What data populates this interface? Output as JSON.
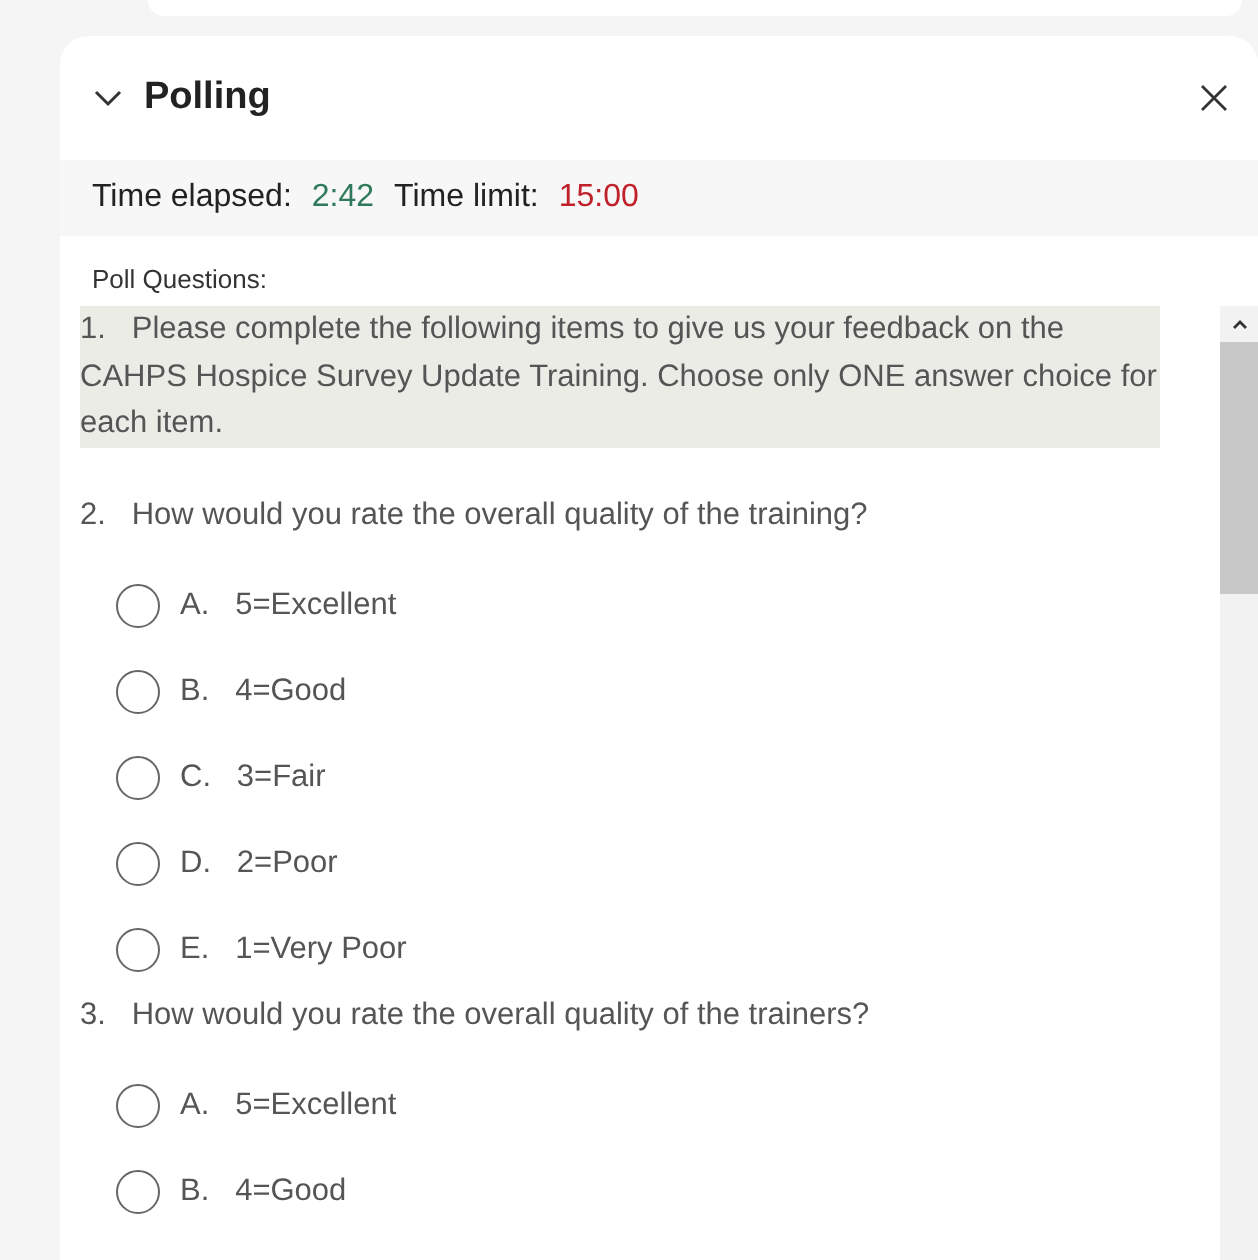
{
  "panel": {
    "title": "Polling",
    "expanded": true
  },
  "timer": {
    "elapsed_label": "Time elapsed:",
    "elapsed": "2:42",
    "limit_label": "Time limit:",
    "limit": "15:00"
  },
  "section_label": "Poll Questions:",
  "questions": [
    {
      "number": "1.",
      "text": "Please complete the following items to give us your feedback on the CAHPS Hospice Survey Update Training. Choose only ONE answer choice for each item.",
      "highlighted": true
    },
    {
      "number": "2.",
      "text": "How would you rate the overall quality of the training?",
      "highlighted": false,
      "options": [
        {
          "letter": "A.",
          "label": "5=Excellent",
          "selected": false
        },
        {
          "letter": "B.",
          "label": "4=Good",
          "selected": false
        },
        {
          "letter": "C.",
          "label": "3=Fair",
          "selected": false
        },
        {
          "letter": "D.",
          "label": "2=Poor",
          "selected": false
        },
        {
          "letter": "E.",
          "label": "1=Very Poor",
          "selected": false
        }
      ]
    },
    {
      "number": "3.",
      "text": "How would you rate the overall quality of the trainers?",
      "highlighted": false,
      "options": [
        {
          "letter": "A.",
          "label": "5=Excellent",
          "selected": false
        },
        {
          "letter": "B.",
          "label": "4=Good",
          "selected": false
        }
      ]
    }
  ]
}
